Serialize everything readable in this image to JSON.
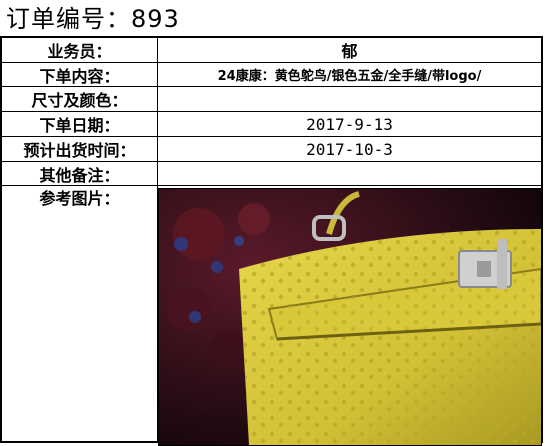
{
  "order": {
    "title_label": "订单编号：",
    "number": "893"
  },
  "fields": [
    {
      "label": "业务员：",
      "value": "郁"
    },
    {
      "label": "下单内容：",
      "value": "24康康：黄色鸵鸟/银色五金/全手缝/带logo/"
    },
    {
      "label": "尺寸及颜色：",
      "value": ""
    },
    {
      "label": "下单日期：",
      "value": "2017-9-13"
    },
    {
      "label": "预计出货时间：",
      "value": "2017-10-3"
    },
    {
      "label": "其他备注：",
      "value": ""
    }
  ],
  "photo": {
    "label": "参考图片：",
    "colors": {
      "leather": "#d8c83a",
      "shadow": "#8a7c1a",
      "background": "#2a0f18",
      "ornament": "#6a1e2a",
      "hardware": "#c8c8c8"
    }
  }
}
